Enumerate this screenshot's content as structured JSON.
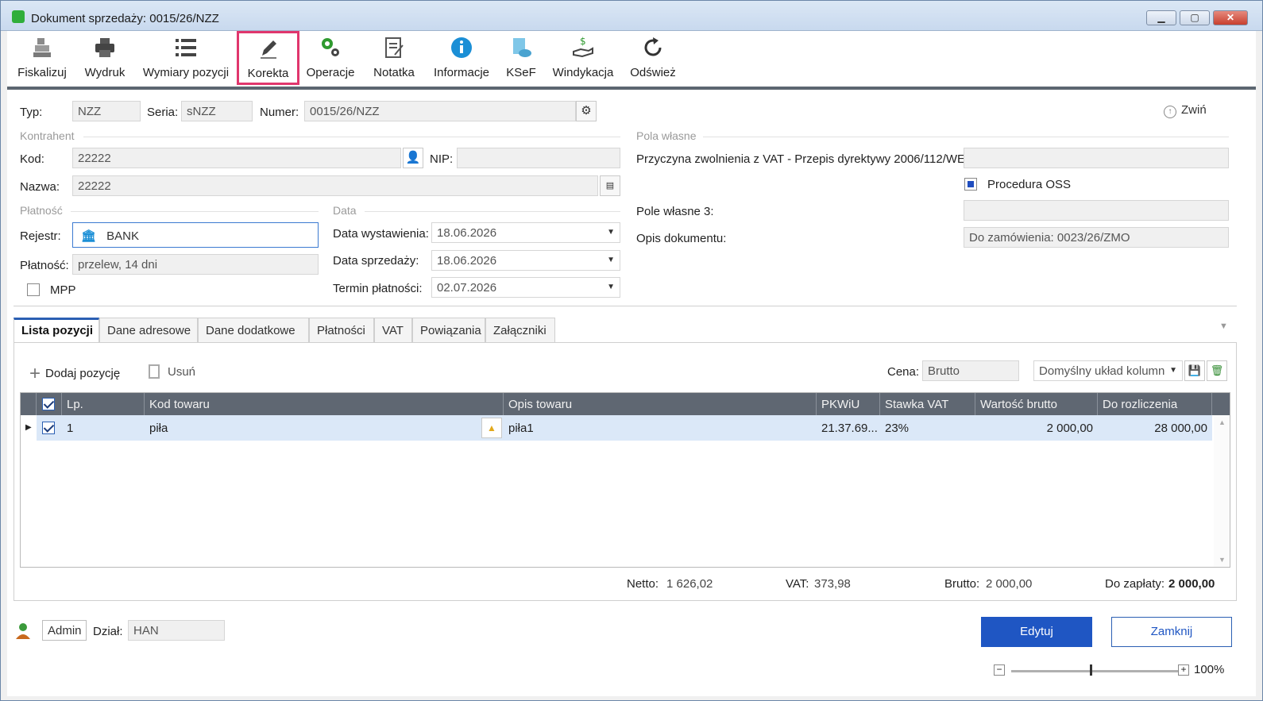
{
  "window": {
    "title": "Dokument sprzedaży: 0015/26/NZZ",
    "minimize": "▁",
    "maximize": "▢",
    "close": "✕"
  },
  "toolbar": [
    {
      "label": "Fiskalizuj",
      "icon": "cash-register-icon"
    },
    {
      "label": "Wydruk",
      "icon": "printer-icon"
    },
    {
      "label": "Wymiary pozycji",
      "icon": "list-icon"
    },
    {
      "label": "Korekta",
      "icon": "pencil-icon"
    },
    {
      "label": "Operacje",
      "icon": "gears-icon"
    },
    {
      "label": "Notatka",
      "icon": "note-icon"
    },
    {
      "label": "Informacje",
      "icon": "info-icon"
    },
    {
      "label": "KSeF",
      "icon": "ksef-cloud-icon"
    },
    {
      "label": "Windykacja",
      "icon": "money-hand-icon"
    },
    {
      "label": "Odśwież",
      "icon": "refresh-icon"
    }
  ],
  "header": {
    "typ_label": "Typ:",
    "typ_value": "NZZ",
    "seria_label": "Seria:",
    "seria_value": "sNZZ",
    "numer_label": "Numer:",
    "numer_value": "0015/26/NZZ",
    "collapse_label": "Zwiń"
  },
  "kontrahent": {
    "section": "Kontrahent",
    "kod_label": "Kod:",
    "kod_value": "22222",
    "nip_label": "NIP:",
    "nip_value": "",
    "nazwa_label": "Nazwa:",
    "nazwa_value": "22222"
  },
  "platnosc": {
    "section": "Płatność",
    "rejestr_label": "Rejestr:",
    "rejestr_value": "BANK",
    "platnosc_label": "Płatność:",
    "platnosc_value": "przelew, 14 dni",
    "mpp_label": "MPP"
  },
  "data": {
    "section": "Data",
    "wystawienia_label": "Data wystawienia:",
    "wystawienia_value": "18.06.2026",
    "sprzedazy_label": "Data sprzedaży:",
    "sprzedazy_value": "18.06.2026",
    "termin_label": "Termin płatności:",
    "termin_value": "02.07.2026"
  },
  "pola_wlasne": {
    "section": "Pola własne",
    "przyczyna_label": "Przyczyna zwolnienia z VAT - Przepis dyrektywy 2006/112/WE:",
    "przyczyna_value": "",
    "oss_label": "Procedura OSS",
    "pole3_label": "Pole własne 3:",
    "pole3_value": "",
    "opis_label": "Opis dokumentu:",
    "opis_value": "Do zamówienia: 0023/26/ZMO"
  },
  "tabs": [
    "Lista pozycji",
    "Dane adresowe",
    "Dane dodatkowe",
    "Płatności",
    "VAT",
    "Powiązania",
    "Załączniki"
  ],
  "positions": {
    "add_label": "Dodaj pozycję",
    "remove_label": "Usuń",
    "cena_label": "Cena:",
    "cena_value": "Brutto",
    "layout_value": "Domyślny układ kolumn",
    "columns": [
      "Lp.",
      "Kod towaru",
      "Opis towaru",
      "PKWiU",
      "Stawka VAT",
      "Wartość brutto",
      "Do rozliczenia"
    ],
    "rows": [
      {
        "lp": "1",
        "kod": "piła",
        "opis": "piła1",
        "pkwiu": "21.37.69...",
        "vat": "23%",
        "brutto": "2 000,00",
        "rozliczenia": "28 000,00"
      }
    ]
  },
  "totals": {
    "netto_label": "Netto:",
    "netto_value": "1 626,02",
    "vat_label": "VAT:",
    "vat_value": "373,98",
    "brutto_label": "Brutto:",
    "brutto_value": "2 000,00",
    "zaplaty_label": "Do zapłaty:",
    "zaplaty_value": "2 000,00"
  },
  "footer": {
    "user": "Admin",
    "dzial_label": "Dział:",
    "dzial_value": "HAN",
    "edit_label": "Edytuj",
    "close_label": "Zamknij",
    "zoom": "100%",
    "zoom_level": 0.47
  },
  "colors": {
    "accent": "#1f56c3",
    "highlight": "#e0366d",
    "grid_header": "#5f6772",
    "selected_row": "#dbe8f8"
  }
}
